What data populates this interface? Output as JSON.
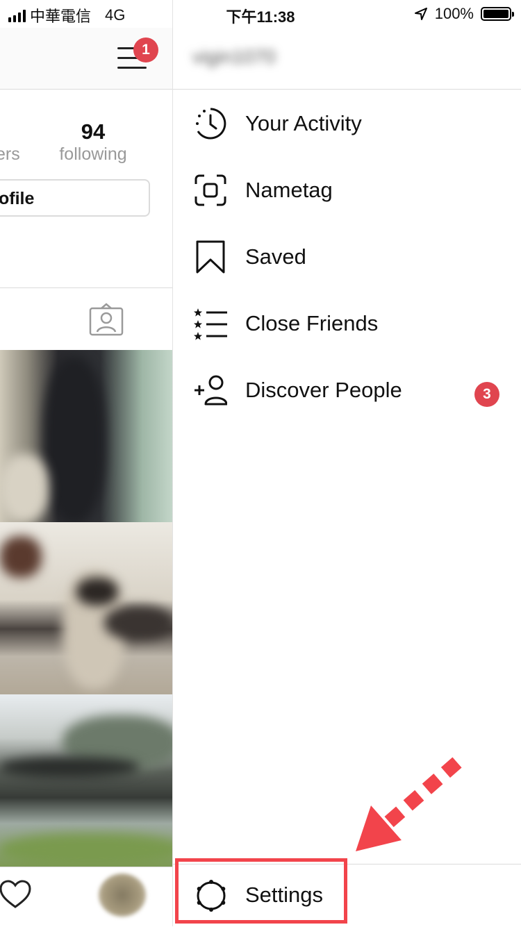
{
  "status_bar": {
    "carrier": "中華電信",
    "network": "4G",
    "time": "下午11:38",
    "battery": "100%",
    "battery_level": 1.0
  },
  "profile": {
    "notification_count": "1",
    "followers_partial": "ers",
    "following_count": "94",
    "following_label": "following",
    "edit_profile_partial": "ofile"
  },
  "drawer": {
    "items": [
      {
        "label": "Your Activity",
        "icon": "activity-clock-icon"
      },
      {
        "label": "Nametag",
        "icon": "nametag-icon"
      },
      {
        "label": "Saved",
        "icon": "bookmark-icon"
      },
      {
        "label": "Close Friends",
        "icon": "close-friends-icon"
      },
      {
        "label": "Discover People",
        "icon": "add-person-icon",
        "badge": "3"
      }
    ],
    "settings_label": "Settings"
  },
  "colors": {
    "badge": "#e0454f",
    "annotation": "#f2444b",
    "divider": "#dbdbdb",
    "secondary_text": "#999999"
  }
}
